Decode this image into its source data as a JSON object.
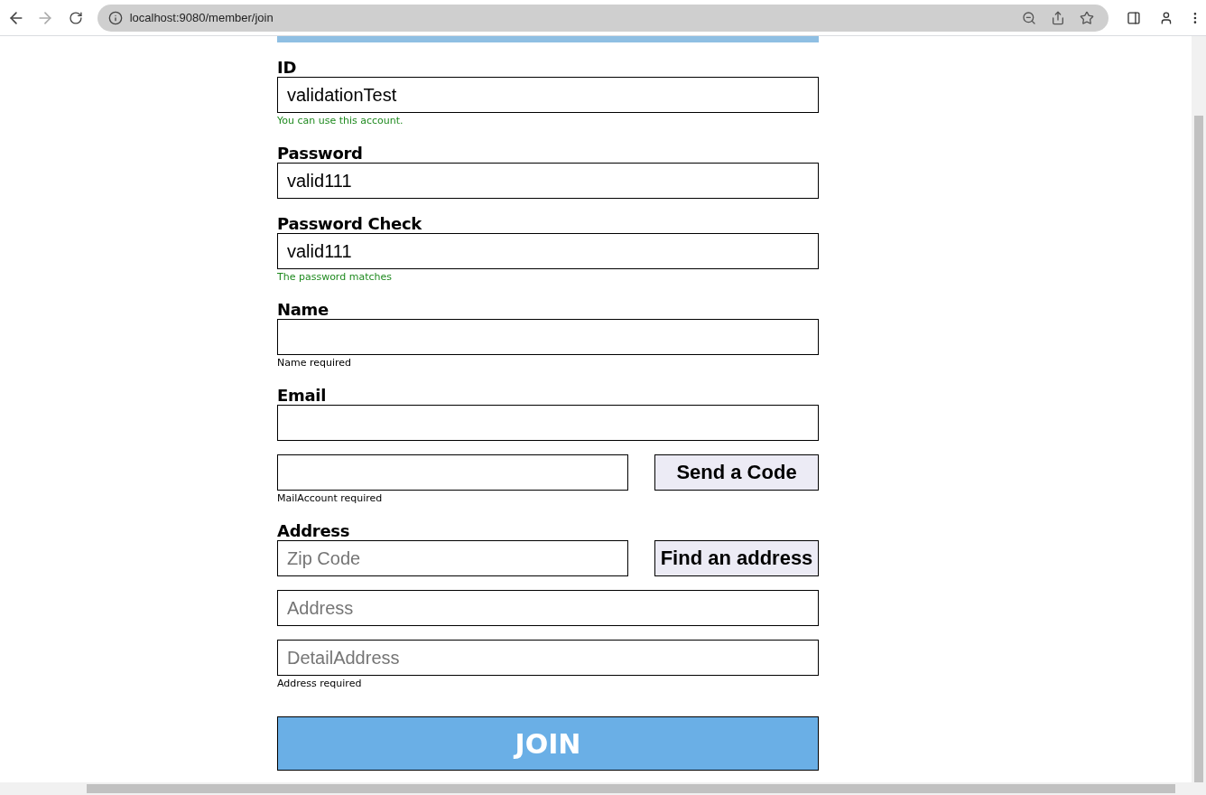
{
  "browser": {
    "url": "localhost:9080/member/join"
  },
  "sections": [
    {
      "label": "ID",
      "rows": [
        {
          "kind": "input",
          "value": "validationTest"
        }
      ],
      "message": {
        "text": "You can use this account.",
        "valid": true
      }
    },
    {
      "label": "Password",
      "rows": [
        {
          "kind": "input",
          "value": "valid111"
        }
      ]
    },
    {
      "label": "Password Check",
      "rows": [
        {
          "kind": "input",
          "value": "valid111"
        }
      ],
      "message": {
        "text": "The password matches",
        "valid": true
      }
    },
    {
      "label": "Name",
      "rows": [
        {
          "kind": "input"
        }
      ],
      "message": {
        "text": "Name required",
        "valid": false
      }
    },
    {
      "label": "Email",
      "rows": [
        {
          "kind": "input"
        },
        {
          "kind": "input_button",
          "button": "Send a Code"
        }
      ],
      "message": {
        "text": "MailAccount required",
        "valid": false
      }
    },
    {
      "label": "Address",
      "rows": [
        {
          "kind": "input_button",
          "placeholder": "Zip Code",
          "button": "Find an address"
        },
        {
          "kind": "input",
          "placeholder": "Address"
        },
        {
          "kind": "input",
          "placeholder": "DetailAddress"
        }
      ],
      "message": {
        "text": "Address required",
        "valid": false
      }
    }
  ],
  "submit": "JOIN"
}
